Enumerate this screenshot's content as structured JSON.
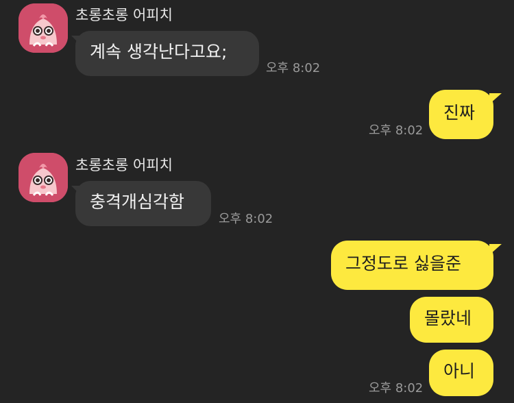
{
  "chat": {
    "colors": {
      "background": "#242424",
      "incoming_bubble": "#383838",
      "outgoing_bubble": "#fde93f",
      "avatar_bg": "#cf4d6a"
    },
    "group1": {
      "sender": "초롱초롱 어피치",
      "avatar_icon": "apeach-avatar-icon",
      "message": "계속 생각난다고요;",
      "time": "오후 8:02"
    },
    "reply1": {
      "message": "진짜",
      "time": "오후 8:02"
    },
    "group2": {
      "sender": "초롱초롱 어피치",
      "avatar_icon": "apeach-avatar-icon",
      "message": "충격개심각함",
      "time": "오후 8:02"
    },
    "reply2": {
      "messages": [
        "그정도로 싫을준",
        "몰랐네",
        "아니"
      ],
      "time": "오후 8:02"
    }
  }
}
